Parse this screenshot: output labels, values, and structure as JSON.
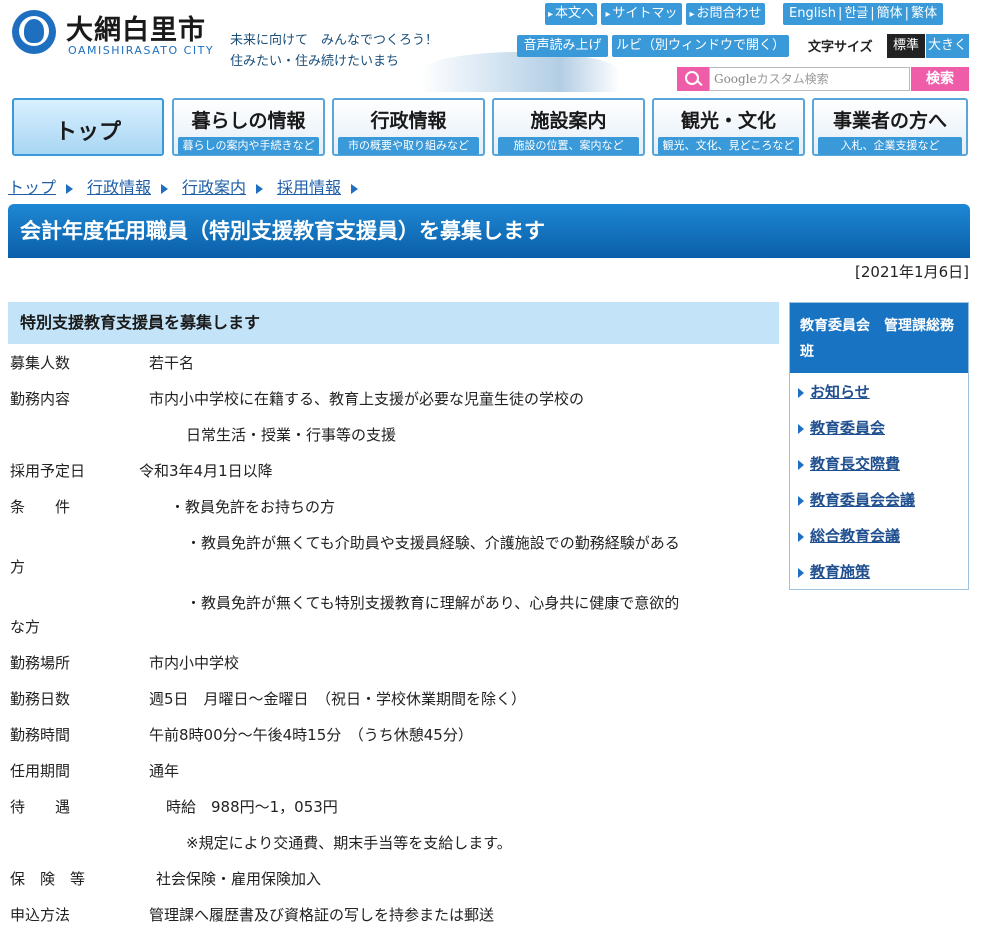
{
  "header": {
    "site_name": "大網白里市",
    "site_name_en": "OAMISHIRASATO CITY",
    "slogan_1": "未来に向けて　みんなでつくろう！",
    "slogan_2": "住みたい・住み続けたいまち",
    "links": [
      "本文へ",
      "サイトマップ",
      "お問合わせ"
    ],
    "langs": [
      "English",
      "한글",
      "簡体",
      "繁体"
    ],
    "voice": "音声読み上げ",
    "ruby": "ルビ（別ウィンドウで開く）",
    "font_size_label": "文字サイズ",
    "font_std": "標準",
    "font_large": "大きく",
    "search_google": "Google",
    "search_placeholder": "カスタム検索",
    "search_button": "検索"
  },
  "nav": [
    {
      "title": "トップ",
      "sub": ""
    },
    {
      "title": "暮らしの情報",
      "sub": "暮らしの案内や手続きなど"
    },
    {
      "title": "行政情報",
      "sub": "市の概要や取り組みなど"
    },
    {
      "title": "施設案内",
      "sub": "施設の位置、案内など"
    },
    {
      "title": "観光・文化",
      "sub": "観光、文化、見どころなど"
    },
    {
      "title": "事業者の方へ",
      "sub": "入札、企業支援など"
    }
  ],
  "breadcrumb": [
    "トップ",
    "行政情報",
    "行政案内",
    "採用情報"
  ],
  "page_title": "会計年度任用職員（特別支援教育支援員）を募集します",
  "date": "[2021年1月6日]",
  "section_title": "特別支援教育支援員を募集します",
  "details": {
    "r1_label": "募集人数",
    "r1_value": "若干名",
    "r2_label": "勤務内容",
    "r2_value": "市内小中学校に在籍する、教育上支援が必要な児童生徒の学校の",
    "r2_cont": "日常生活・授業・行事等の支援",
    "r3_label": "採用予定日",
    "r3_value": "令和3年4月1日以降",
    "r4_label": "条　　件",
    "r4_value": "・教員免許をお持ちの方",
    "r4_v2": "・教員免許が無くても介助員や支援員経験、介護施設での勤務経験がある",
    "r4_v2b": "方",
    "r4_v3": "・教員免許が無くても特別支援教育に理解があり、心身共に健康で意欲的",
    "r4_v3b": "な方",
    "r5_label": "勤務場所",
    "r5_value": "市内小中学校",
    "r6_label": "勤務日数",
    "r6_value": "週5日　月曜日～金曜日　（祝日・学校休業期間を除く）",
    "r7_label": "勤務時間",
    "r7_value": "午前8時00分～午後4時15分　（うち休憩45分）",
    "r8_label": "任用期間",
    "r8_value": "通年",
    "r9_label": "待　　遇",
    "r9_value": "時給　988円～1，053円",
    "r9_cont": "※規定により交通費、期末手当等を支給します。",
    "r10_label": "保　険　等",
    "r10_value": "社会保険・雇用保険加入",
    "r11_label": "申込方法",
    "r11_value": "管理課へ履歴書及び資格証の写しを持参または郵送"
  },
  "sidebar": {
    "title": "教育委員会　管理課総務班",
    "items": [
      "お知らせ",
      "教育委員会",
      "教育長交際費",
      "教育委員会会議",
      "総合教育会議",
      "教育施策"
    ]
  }
}
